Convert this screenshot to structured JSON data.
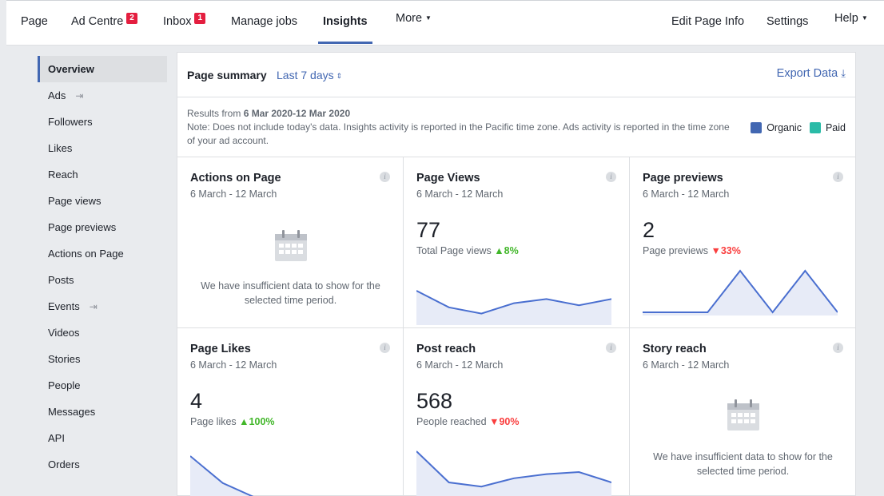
{
  "nav": {
    "items": [
      {
        "label": "Page"
      },
      {
        "label": "Ad Centre",
        "badge": "2"
      },
      {
        "label": "Inbox",
        "badge": "1"
      },
      {
        "label": "Manage jobs"
      },
      {
        "label": "Insights"
      },
      {
        "label": "More"
      }
    ],
    "right": [
      {
        "label": "Edit Page Info"
      },
      {
        "label": "Settings"
      },
      {
        "label": "Help"
      }
    ]
  },
  "sidebar": {
    "items": [
      {
        "label": "Overview"
      },
      {
        "label": "Ads",
        "icon": "export-icon"
      },
      {
        "label": "Followers"
      },
      {
        "label": "Likes"
      },
      {
        "label": "Reach"
      },
      {
        "label": "Page views"
      },
      {
        "label": "Page previews"
      },
      {
        "label": "Actions on Page"
      },
      {
        "label": "Posts"
      },
      {
        "label": "Events",
        "icon": "export-icon"
      },
      {
        "label": "Videos"
      },
      {
        "label": "Stories"
      },
      {
        "label": "People"
      },
      {
        "label": "Messages"
      },
      {
        "label": "API"
      },
      {
        "label": "Orders"
      }
    ]
  },
  "summary": {
    "title": "Page summary",
    "range": "Last 7 days",
    "export": "Export Data",
    "results_prefix": "Results from ",
    "results_dates": "6 Mar 2020-12 Mar 2020",
    "note": "Note: Does not include today's data. Insights activity is reported in the Pacific time zone. Ads activity is reported in the time zone of your ad account.",
    "legend": [
      {
        "label": "Organic",
        "color": "#4267b2"
      },
      {
        "label": "Paid",
        "color": "#2abba7"
      }
    ]
  },
  "cards": [
    {
      "title": "Actions on Page",
      "sub": "6 March - 12 March",
      "empty": "We have insufficient data to show for the selected time period."
    },
    {
      "title": "Page Views",
      "sub": "6 March - 12 March",
      "value": "77",
      "label": "Total Page views",
      "delta": "8%",
      "dir": "up",
      "spark": [
        0.75,
        0.35,
        0.2,
        0.45,
        0.55,
        0.4,
        0.55
      ]
    },
    {
      "title": "Page previews",
      "sub": "6 March - 12 March",
      "value": "2",
      "label": "Page previews",
      "delta": "33%",
      "dir": "down",
      "spark": [
        0,
        0,
        0,
        1,
        0,
        1,
        0
      ]
    },
    {
      "title": "Page Likes",
      "sub": "6 March - 12 March",
      "value": "4",
      "label": "Page likes",
      "delta": "100%",
      "dir": "up",
      "spark": [
        1,
        0.35,
        0,
        0,
        0,
        0,
        0
      ]
    },
    {
      "title": "Post reach",
      "sub": "6 March - 12 March",
      "value": "568",
      "label": "People reached",
      "delta": "90%",
      "dir": "down",
      "spark": [
        1,
        0.25,
        0.15,
        0.35,
        0.45,
        0.5,
        0.25
      ]
    },
    {
      "title": "Story reach",
      "sub": "6 March - 12 March",
      "empty": "We have insufficient data to show for the selected time period."
    }
  ],
  "colors": {
    "line": "#4a6fd0",
    "fill": "#e7ebf7",
    "accent": "#4267b2"
  }
}
